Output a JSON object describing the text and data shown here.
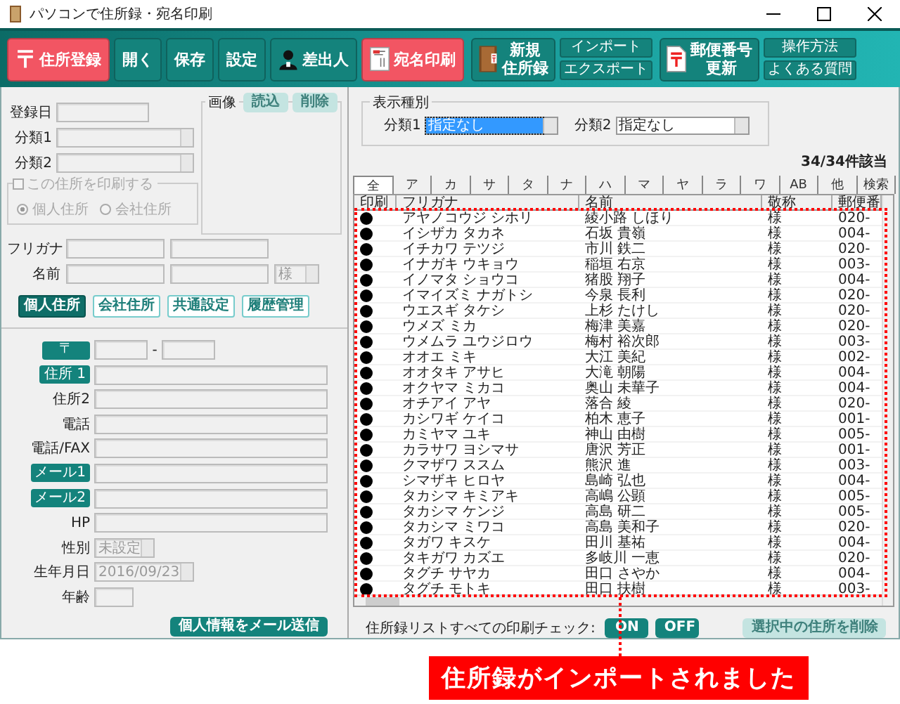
{
  "window": {
    "title": "パソコンで住所録・宛名印刷"
  },
  "toolbar": [
    {
      "kind": "button",
      "label": "住所登録",
      "highlighted": true
    },
    {
      "kind": "button",
      "label": "開く",
      "highlighted": false
    },
    {
      "kind": "button",
      "label": "保存",
      "highlighted": false
    },
    {
      "kind": "button",
      "label": "設定",
      "highlighted": false
    },
    {
      "kind": "button",
      "label": "差出人",
      "highlighted": false
    },
    {
      "kind": "button",
      "label": "宛名印刷",
      "highlighted": true
    },
    {
      "kind": "tall",
      "lines": [
        "新規",
        "住所録"
      ]
    },
    {
      "kind": "stack",
      "buttons": [
        "インポート",
        "エクスポート"
      ]
    },
    {
      "kind": "tall",
      "lines": [
        "郵便番号",
        "更新"
      ]
    },
    {
      "kind": "stack",
      "buttons": [
        "操作方法",
        "よくある質問"
      ]
    }
  ],
  "record": {
    "date_label": "登録日",
    "categories": [
      {
        "label": "分類1"
      },
      {
        "label": "分類2"
      }
    ],
    "print_group": {
      "label": "この住所を印刷する",
      "checked": false,
      "disabled": true,
      "options": [
        {
          "label": "個人住所",
          "selected": true
        },
        {
          "label": "会社住所",
          "selected": false
        }
      ]
    },
    "image": {
      "label": "画像",
      "buttons": [
        {
          "label": "読込",
          "disabled": true
        },
        {
          "label": "削除",
          "disabled": true
        }
      ]
    },
    "furigana_label": "フリガナ",
    "name_label": "名前",
    "honorific": "様"
  },
  "tabs": [
    {
      "label": "個人住所",
      "selected": true
    },
    {
      "label": "会社住所",
      "selected": false
    },
    {
      "label": "共通設定",
      "selected": false
    },
    {
      "label": "履歴管理",
      "selected": false
    }
  ],
  "fields": [
    {
      "kind": "postal",
      "label": "〒",
      "label_button": true,
      "separator": "-"
    },
    {
      "kind": "text",
      "label": "住所 1",
      "label_button": true
    },
    {
      "kind": "text",
      "label": "住所2",
      "label_button": false
    },
    {
      "kind": "text",
      "label": "電話",
      "label_button": false
    },
    {
      "kind": "text",
      "label": "電話/FAX",
      "label_button": false
    },
    {
      "kind": "text",
      "label": "メール1",
      "label_button": true
    },
    {
      "kind": "text",
      "label": "メール2",
      "label_button": true
    },
    {
      "kind": "text",
      "label": "HP",
      "label_button": false
    },
    {
      "kind": "select",
      "label": "性別",
      "label_button": false,
      "value": "未設定"
    },
    {
      "kind": "select",
      "label": "生年月日",
      "label_button": false,
      "value": "2016/09/23"
    },
    {
      "kind": "small",
      "label": "年齢",
      "label_button": false
    }
  ],
  "mail_button": "個人情報をメール送信",
  "filter": {
    "label": "表示種別",
    "selects": [
      {
        "label": "分類1",
        "value": "指定なし",
        "focused": true
      },
      {
        "label": "分類2",
        "value": "指定なし",
        "focused": false
      }
    ]
  },
  "count": "34/34件該当",
  "kana_tabs": [
    {
      "label": "全",
      "selected": true
    },
    {
      "label": "ア",
      "selected": false
    },
    {
      "label": "カ",
      "selected": false
    },
    {
      "label": "サ",
      "selected": false
    },
    {
      "label": "タ",
      "selected": false
    },
    {
      "label": "ナ",
      "selected": false
    },
    {
      "label": "ハ",
      "selected": false
    },
    {
      "label": "マ",
      "selected": false
    },
    {
      "label": "ヤ",
      "selected": false
    },
    {
      "label": "ラ",
      "selected": false
    },
    {
      "label": "ワ",
      "selected": false
    },
    {
      "label": "AB",
      "selected": false
    },
    {
      "label": "他",
      "selected": false
    },
    {
      "label": "検索",
      "selected": false
    }
  ],
  "table": {
    "columns": [
      "印刷",
      "フリガナ",
      "名前",
      "敬称",
      "郵便番"
    ],
    "rows": [
      {
        "print": true,
        "furigana": "アヤノコウジ シホリ",
        "name": "綾小路 しほり",
        "honorific": "様",
        "postal": "020-"
      },
      {
        "print": true,
        "furigana": "イシザカ タカネ",
        "name": "石坂 貴嶺",
        "honorific": "様",
        "postal": "004-"
      },
      {
        "print": true,
        "furigana": "イチカワ テツジ",
        "name": "市川 鉄二",
        "honorific": "様",
        "postal": "020-"
      },
      {
        "print": true,
        "furigana": "イナガキ ウキョウ",
        "name": "稲垣 右京",
        "honorific": "様",
        "postal": "003-"
      },
      {
        "print": true,
        "furigana": "イノマタ ショウコ",
        "name": "猪股 翔子",
        "honorific": "様",
        "postal": "004-"
      },
      {
        "print": true,
        "furigana": "イマイズミ ナガトシ",
        "name": "今泉 長利",
        "honorific": "様",
        "postal": "020-"
      },
      {
        "print": true,
        "furigana": "ウエスギ タケシ",
        "name": "上杉 たけし",
        "honorific": "様",
        "postal": "020-"
      },
      {
        "print": true,
        "furigana": "ウメズ ミカ",
        "name": "梅津 美嘉",
        "honorific": "様",
        "postal": "020-"
      },
      {
        "print": true,
        "furigana": "ウメムラ ユウジロウ",
        "name": "梅村 裕次郎",
        "honorific": "様",
        "postal": "003-"
      },
      {
        "print": true,
        "furigana": "オオエ ミキ",
        "name": "大江 美紀",
        "honorific": "様",
        "postal": "002-"
      },
      {
        "print": true,
        "furigana": "オオタキ アサヒ",
        "name": "大滝 朝陽",
        "honorific": "様",
        "postal": "004-"
      },
      {
        "print": true,
        "furigana": "オクヤマ ミカコ",
        "name": "奥山 未華子",
        "honorific": "様",
        "postal": "004-"
      },
      {
        "print": true,
        "furigana": "オチアイ アヤ",
        "name": "落合 綾",
        "honorific": "様",
        "postal": "020-"
      },
      {
        "print": true,
        "furigana": "カシワギ ケイコ",
        "name": "柏木 恵子",
        "honorific": "様",
        "postal": "001-"
      },
      {
        "print": true,
        "furigana": "カミヤマ ユキ",
        "name": "神山 由樹",
        "honorific": "様",
        "postal": "005-"
      },
      {
        "print": true,
        "furigana": "カラサワ ヨシマサ",
        "name": "唐沢 芳正",
        "honorific": "様",
        "postal": "001-"
      },
      {
        "print": true,
        "furigana": "クマザワ ススム",
        "name": "熊沢 進",
        "honorific": "様",
        "postal": "003-"
      },
      {
        "print": true,
        "furigana": "シマザキ ヒロヤ",
        "name": "島崎 弘也",
        "honorific": "様",
        "postal": "004-"
      },
      {
        "print": true,
        "furigana": "タカシマ キミアキ",
        "name": "高嶋 公顕",
        "honorific": "様",
        "postal": "005-"
      },
      {
        "print": true,
        "furigana": "タカシマ ケンジ",
        "name": "高島 研二",
        "honorific": "様",
        "postal": "005-"
      },
      {
        "print": true,
        "furigana": "タカシマ ミワコ",
        "name": "高島 美和子",
        "honorific": "様",
        "postal": "020-"
      },
      {
        "print": true,
        "furigana": "タガワ キスケ",
        "name": "田川 基祐",
        "honorific": "様",
        "postal": "004-"
      },
      {
        "print": true,
        "furigana": "タキガワ カズエ",
        "name": "多岐川 一恵",
        "honorific": "様",
        "postal": "020-"
      },
      {
        "print": true,
        "furigana": "タグチ サヤカ",
        "name": "田口 さやか",
        "honorific": "様",
        "postal": "004-"
      },
      {
        "print": true,
        "furigana": "タグチ モトキ",
        "name": "田口 扶樹",
        "honorific": "様",
        "postal": "003-"
      }
    ]
  },
  "bulk_print": {
    "label": "住所録リストすべての印刷チェック:",
    "buttons": [
      "ON",
      "OFF"
    ]
  },
  "delete_button": {
    "label": "選択中の住所を削除",
    "disabled": true
  },
  "callout": "住所録がインポートされました"
}
